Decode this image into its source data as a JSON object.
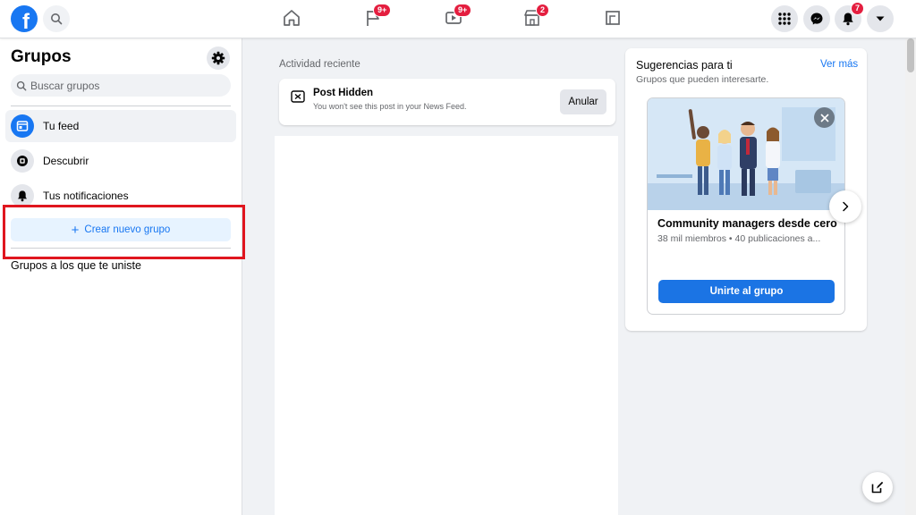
{
  "topbar": {
    "logo_letter": "f",
    "nav_badges": {
      "pages": "9+",
      "watch": "9+",
      "marketplace": "2"
    },
    "notifications_badge": "7"
  },
  "sidebar": {
    "title": "Grupos",
    "search_placeholder": "Buscar grupos",
    "items": [
      {
        "label": "Tu feed",
        "icon": "feed-icon",
        "active": true
      },
      {
        "label": "Descubrir",
        "icon": "discover-icon",
        "active": false
      },
      {
        "label": "Tus notificaciones",
        "icon": "bell-icon",
        "active": false
      }
    ],
    "create_label": "Crear nuevo grupo",
    "create_plus": "+",
    "joined_title": "Grupos a los que te uniste"
  },
  "main": {
    "recent_label": "Actividad reciente",
    "post_hidden": {
      "title": "Post Hidden",
      "subtitle": "You won't see this post in your News Feed.",
      "undo_label": "Anular"
    }
  },
  "suggestions": {
    "title": "Sugerencias para ti",
    "see_more": "Ver más",
    "subtitle": "Grupos que pueden interesarte.",
    "group": {
      "name": "Community managers desde cero",
      "meta": "38 mil miembros • 40 publicaciones a...",
      "join_label": "Unirte al grupo"
    }
  },
  "colors": {
    "brand": "#1877f2",
    "badge": "#e41e3f",
    "highlight": "#e0161f"
  }
}
